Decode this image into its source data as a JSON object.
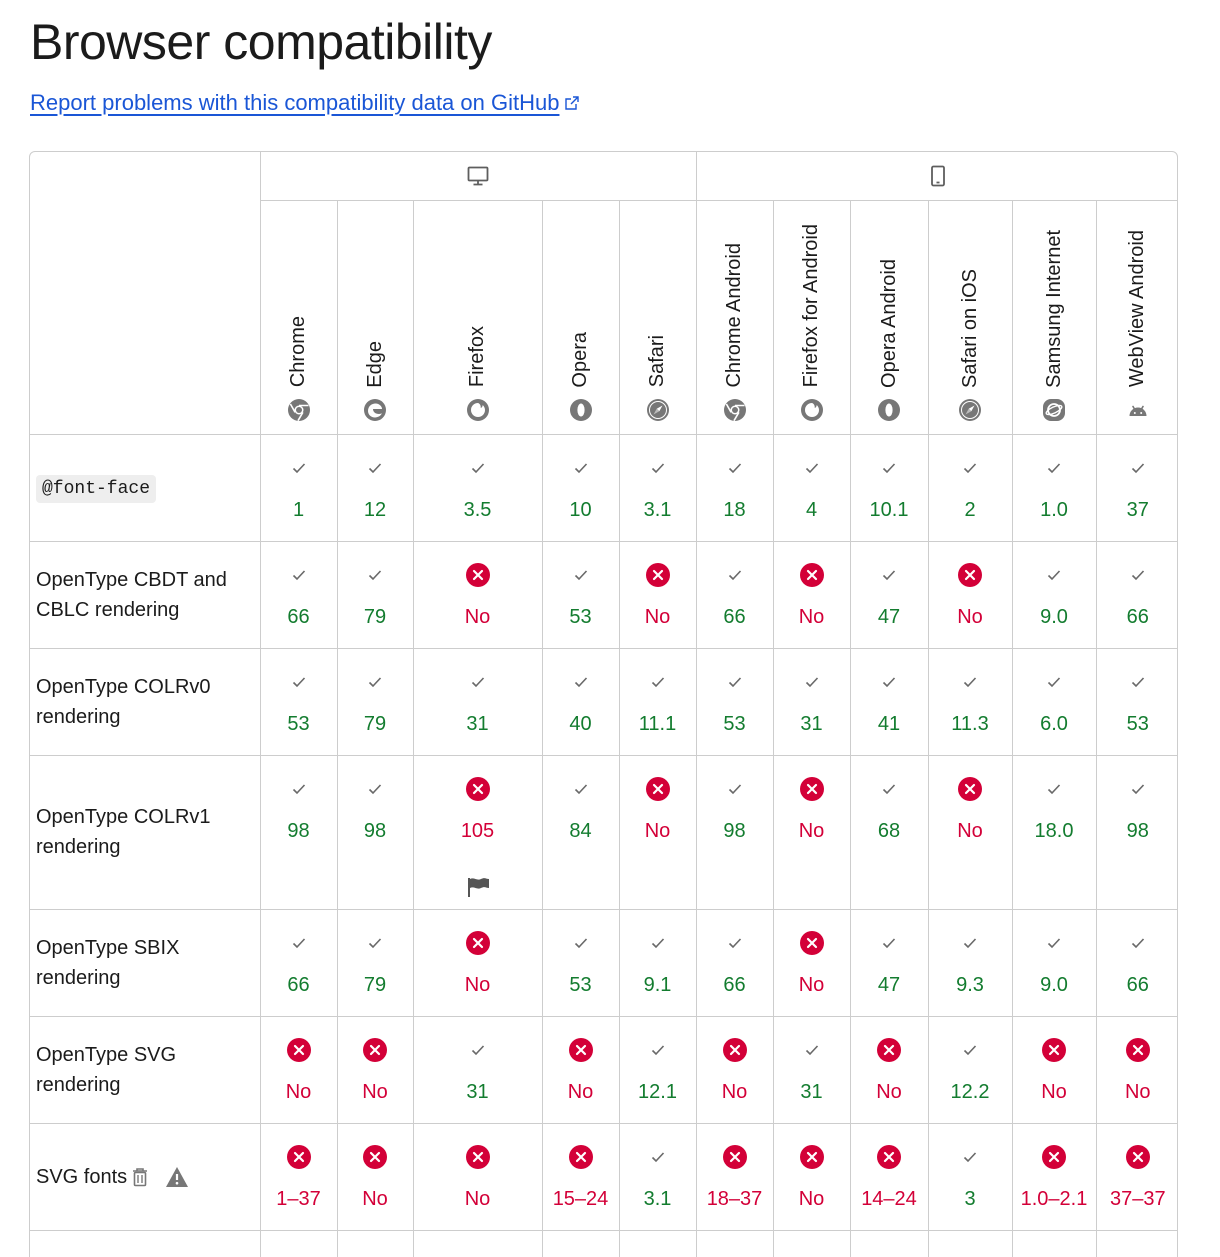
{
  "page": {
    "title": "Browser compatibility",
    "report_link": "Report problems with this compatibility data on GitHub"
  },
  "platforms": [
    {
      "name": "desktop",
      "icon": "desktop-icon",
      "span": 5
    },
    {
      "name": "mobile",
      "icon": "mobile-icon",
      "span": 6
    }
  ],
  "browsers": [
    {
      "key": "chrome",
      "name": "Chrome",
      "icon": "chrome-icon"
    },
    {
      "key": "edge",
      "name": "Edge",
      "icon": "edge-icon"
    },
    {
      "key": "firefox",
      "name": "Firefox",
      "icon": "firefox-icon"
    },
    {
      "key": "opera",
      "name": "Opera",
      "icon": "opera-icon"
    },
    {
      "key": "safari",
      "name": "Safari",
      "icon": "safari-icon"
    },
    {
      "key": "chrome_android",
      "name": "Chrome Android",
      "icon": "chrome-icon"
    },
    {
      "key": "firefox_android",
      "name": "Firefox for Android",
      "icon": "firefox-icon"
    },
    {
      "key": "opera_android",
      "name": "Opera Android",
      "icon": "opera-icon"
    },
    {
      "key": "safari_ios",
      "name": "Safari on iOS",
      "icon": "safari-icon"
    },
    {
      "key": "samsung",
      "name": "Samsung Internet",
      "icon": "samsung-icon"
    },
    {
      "key": "webview",
      "name": "WebView Android",
      "icon": "android-icon"
    }
  ],
  "features": [
    {
      "name": "@font-face",
      "is_code": true,
      "support": [
        {
          "s": "yes",
          "v": "1"
        },
        {
          "s": "yes",
          "v": "12"
        },
        {
          "s": "yes",
          "v": "3.5"
        },
        {
          "s": "yes",
          "v": "10"
        },
        {
          "s": "yes",
          "v": "3.1"
        },
        {
          "s": "yes",
          "v": "18"
        },
        {
          "s": "yes",
          "v": "4"
        },
        {
          "s": "yes",
          "v": "10.1"
        },
        {
          "s": "yes",
          "v": "2"
        },
        {
          "s": "yes",
          "v": "1.0"
        },
        {
          "s": "yes",
          "v": "37"
        }
      ]
    },
    {
      "name": "OpenType CBDT and CBLC rendering",
      "support": [
        {
          "s": "yes",
          "v": "66"
        },
        {
          "s": "yes",
          "v": "79"
        },
        {
          "s": "no",
          "v": "No"
        },
        {
          "s": "yes",
          "v": "53"
        },
        {
          "s": "no",
          "v": "No"
        },
        {
          "s": "yes",
          "v": "66"
        },
        {
          "s": "no",
          "v": "No"
        },
        {
          "s": "yes",
          "v": "47"
        },
        {
          "s": "no",
          "v": "No"
        },
        {
          "s": "yes",
          "v": "9.0"
        },
        {
          "s": "yes",
          "v": "66"
        }
      ]
    },
    {
      "name": "OpenType COLRv0 rendering",
      "support": [
        {
          "s": "yes",
          "v": "53"
        },
        {
          "s": "yes",
          "v": "79"
        },
        {
          "s": "yes",
          "v": "31"
        },
        {
          "s": "yes",
          "v": "40"
        },
        {
          "s": "yes",
          "v": "11.1"
        },
        {
          "s": "yes",
          "v": "53"
        },
        {
          "s": "yes",
          "v": "31"
        },
        {
          "s": "yes",
          "v": "41"
        },
        {
          "s": "yes",
          "v": "11.3"
        },
        {
          "s": "yes",
          "v": "6.0"
        },
        {
          "s": "yes",
          "v": "53"
        }
      ]
    },
    {
      "name": "OpenType COLRv1 rendering",
      "support": [
        {
          "s": "yes",
          "v": "98"
        },
        {
          "s": "yes",
          "v": "98"
        },
        {
          "s": "no",
          "v": "105",
          "flag": true
        },
        {
          "s": "yes",
          "v": "84"
        },
        {
          "s": "no",
          "v": "No"
        },
        {
          "s": "yes",
          "v": "98"
        },
        {
          "s": "no",
          "v": "No"
        },
        {
          "s": "yes",
          "v": "68"
        },
        {
          "s": "no",
          "v": "No"
        },
        {
          "s": "yes",
          "v": "18.0"
        },
        {
          "s": "yes",
          "v": "98"
        }
      ]
    },
    {
      "name": "OpenType SBIX rendering",
      "support": [
        {
          "s": "yes",
          "v": "66"
        },
        {
          "s": "yes",
          "v": "79"
        },
        {
          "s": "no",
          "v": "No"
        },
        {
          "s": "yes",
          "v": "53"
        },
        {
          "s": "yes",
          "v": "9.1"
        },
        {
          "s": "yes",
          "v": "66"
        },
        {
          "s": "no",
          "v": "No"
        },
        {
          "s": "yes",
          "v": "47"
        },
        {
          "s": "yes",
          "v": "9.3"
        },
        {
          "s": "yes",
          "v": "9.0"
        },
        {
          "s": "yes",
          "v": "66"
        }
      ]
    },
    {
      "name": "OpenType SVG rendering",
      "support": [
        {
          "s": "no",
          "v": "No"
        },
        {
          "s": "no",
          "v": "No"
        },
        {
          "s": "yes",
          "v": "31"
        },
        {
          "s": "no",
          "v": "No"
        },
        {
          "s": "yes",
          "v": "12.1"
        },
        {
          "s": "no",
          "v": "No"
        },
        {
          "s": "yes",
          "v": "31"
        },
        {
          "s": "no",
          "v": "No"
        },
        {
          "s": "yes",
          "v": "12.2"
        },
        {
          "s": "no",
          "v": "No"
        },
        {
          "s": "no",
          "v": "No"
        }
      ]
    },
    {
      "name": "SVG fonts",
      "deprecated": true,
      "non_standard": true,
      "support": [
        {
          "s": "no",
          "v": "1–37"
        },
        {
          "s": "no",
          "v": "No"
        },
        {
          "s": "no",
          "v": "No"
        },
        {
          "s": "no",
          "v": "15–24"
        },
        {
          "s": "yes",
          "v": "3.1"
        },
        {
          "s": "no",
          "v": "18–37"
        },
        {
          "s": "no",
          "v": "No"
        },
        {
          "s": "no",
          "v": "14–24"
        },
        {
          "s": "yes",
          "v": "3"
        },
        {
          "s": "no",
          "v": "1.0–2.1"
        },
        {
          "s": "no",
          "v": "37–37"
        }
      ]
    },
    {
      "name": "",
      "support": [
        {
          "s": "yes",
          "v": ""
        },
        {
          "s": "yes",
          "v": ""
        },
        {
          "s": "yes",
          "v": ""
        },
        {
          "s": "yes",
          "v": ""
        },
        {
          "s": "yes",
          "v": ""
        },
        {
          "s": "yes",
          "v": ""
        },
        {
          "s": "yes",
          "v": ""
        },
        {
          "s": "yes",
          "v": ""
        },
        {
          "s": "yes",
          "v": ""
        },
        {
          "s": "yes",
          "v": ""
        },
        {
          "s": "yes",
          "v": ""
        }
      ]
    }
  ],
  "colors": {
    "yes": "#137c2f",
    "no": "#d30038",
    "link": "#1a56d6",
    "border": "#cdcdcd"
  }
}
